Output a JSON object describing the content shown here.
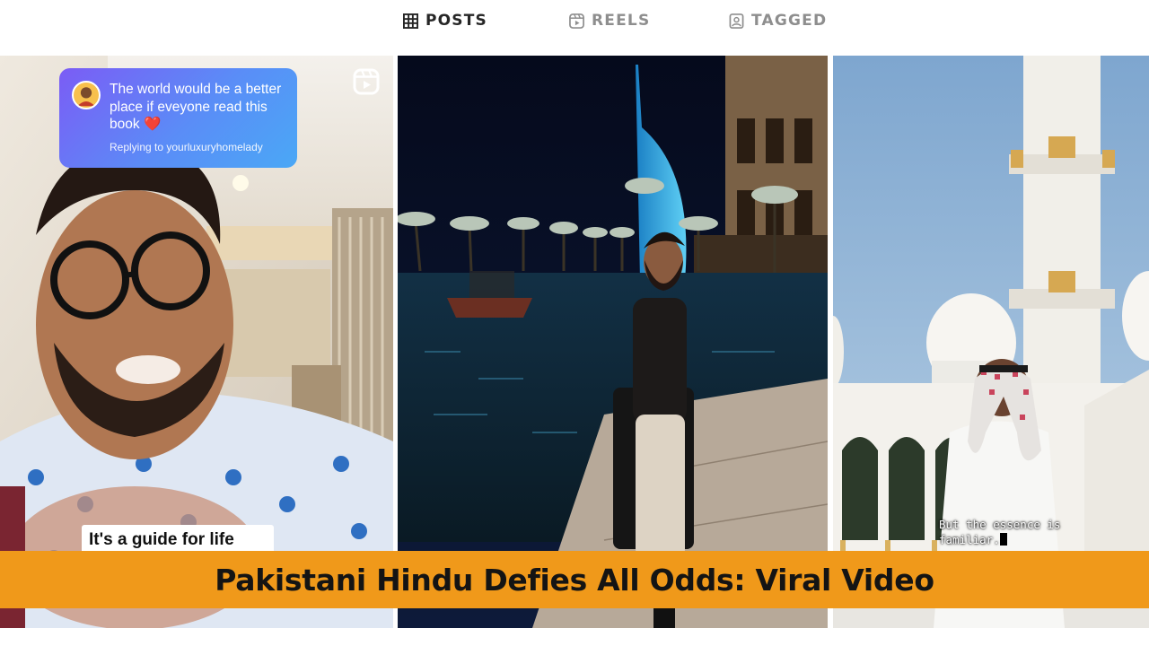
{
  "tabs": [
    {
      "label": "POSTS",
      "icon": "grid-icon",
      "active": true
    },
    {
      "label": "REELS",
      "icon": "reels-icon",
      "active": false
    },
    {
      "label": "TAGGED",
      "icon": "tagged-icon",
      "active": false
    }
  ],
  "posts": [
    {
      "type": "reel",
      "reply": {
        "text": "The world would be a better place if eveyone read this book",
        "emoji": "❤️",
        "replying_to": "Replying to yourluxuryhomelady"
      },
      "caption": "It's a guide for life"
    },
    {
      "type": "photo"
    },
    {
      "type": "photo",
      "caption_lines": [
        "But the essence is",
        "familiar."
      ]
    }
  ],
  "headline": "Pakistani Hindu Defies All Odds: Viral Video",
  "colors": {
    "banner": "#f0991a",
    "tab_active": "#262626",
    "tab_inactive": "#8e8e8e",
    "reply_gradient": [
      "#7b5cf5",
      "#4aa8f6"
    ]
  }
}
